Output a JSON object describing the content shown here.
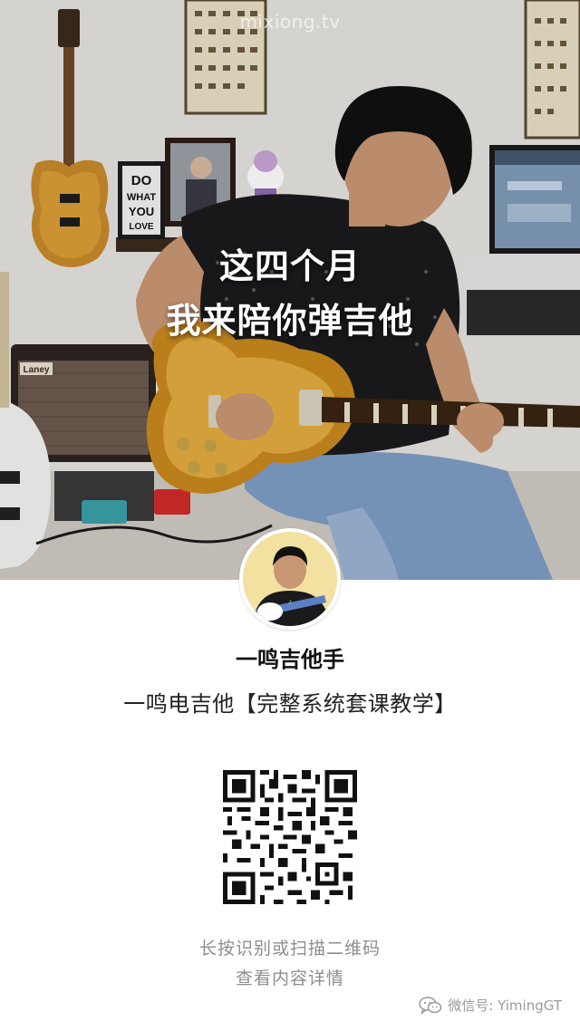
{
  "hero": {
    "watermark": "mixiong.tv",
    "caption_line1": "这四个月",
    "caption_line2": "我来陪你弹吉他",
    "poster_text": [
      "DO",
      "WHAT",
      "YOU",
      "LOVE"
    ],
    "amp_brand": "Laney"
  },
  "profile": {
    "account_name": "一鸣吉他手",
    "description": "一鸣电吉他【完整系统套课教学】"
  },
  "qr": {
    "hint_line1": "长按识别或扫描二维码",
    "hint_line2": "查看内容详情"
  },
  "footer": {
    "icon": "wechat-icon",
    "label": "微信号: YimingGT"
  },
  "colors": {
    "caption": "#ffffff",
    "hint": "#8d8d8d",
    "footer": "#9a9a9a"
  }
}
